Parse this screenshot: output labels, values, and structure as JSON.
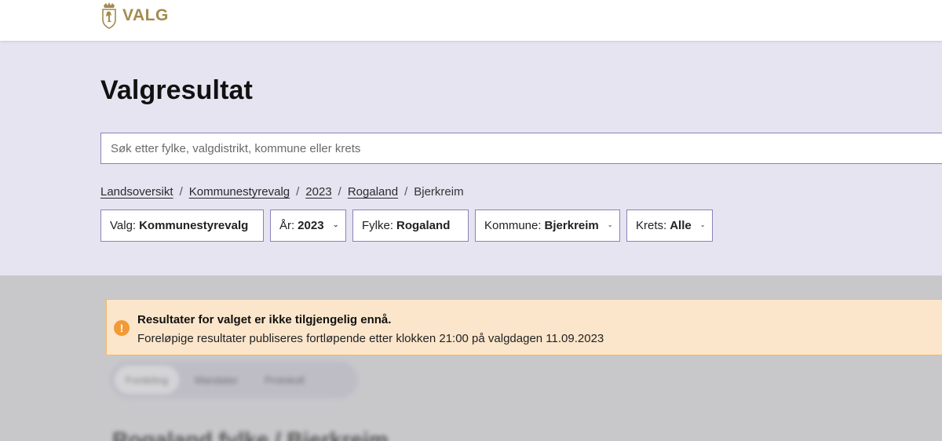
{
  "header": {
    "logo_text": "VALG",
    "logo_icon": "coat-of-arms-icon"
  },
  "hero": {
    "title": "Valgresultat",
    "search": {
      "placeholder": "Søk etter fylke, valgdistrikt, kommune eller krets",
      "value": ""
    },
    "breadcrumb": [
      {
        "label": "Landsoversikt",
        "link": true
      },
      {
        "label": "Kommunestyrevalg",
        "link": true
      },
      {
        "label": "2023",
        "link": true
      },
      {
        "label": "Rogaland",
        "link": true
      },
      {
        "label": "Bjerkreim",
        "link": false
      }
    ],
    "separator": "/",
    "filters": [
      {
        "label": "Valg:",
        "value": "Kommunestyrevalg"
      },
      {
        "label": "År:",
        "value": "2023"
      },
      {
        "label": "Fylke:",
        "value": "Rogaland"
      },
      {
        "label": "Kommune:",
        "value": "Bjerkreim"
      },
      {
        "label": "Krets:",
        "value": "Alle"
      }
    ]
  },
  "notice": {
    "icon": "!",
    "title": "Resultater for valget er ikke tilgjengelig ennå.",
    "text": "Foreløpige resultater publiseres fortløpende etter klokken 21:00 på valgdagen 11.09.2023"
  },
  "blurred": {
    "tabs": [
      "Fordeling",
      "Mandater",
      "Protokoll"
    ],
    "heading": "Rogaland fylke / Bjerkreim"
  },
  "colors": {
    "brand_gold": "#a48a4f",
    "hero_bg": "#e6e4f1",
    "border_accent": "#8a82b8",
    "notice_bg": "#fbe6cb",
    "notice_border": "#f0b86a",
    "notice_icon": "#f29a36"
  }
}
